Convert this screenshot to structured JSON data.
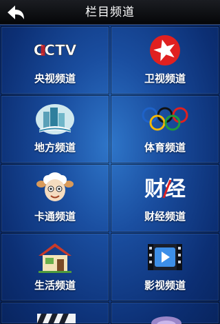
{
  "header": {
    "title": "栏目频道",
    "back_icon": "back-arrow-icon"
  },
  "tiles": [
    {
      "label": "央视频道",
      "icon": "cctv-logo-icon"
    },
    {
      "label": "卫视频道",
      "icon": "star-tv-logo-icon"
    },
    {
      "label": "地方频道",
      "icon": "city-buildings-icon"
    },
    {
      "label": "体育频道",
      "icon": "olympic-rings-icon"
    },
    {
      "label": "卡通频道",
      "icon": "cartoon-sheep-icon"
    },
    {
      "label": "财经频道",
      "icon": "finance-logo-icon"
    },
    {
      "label": "生活频道",
      "icon": "house-icon"
    },
    {
      "label": "影视频道",
      "icon": "film-play-icon"
    }
  ],
  "logos": {
    "cctv_text": "CCTV",
    "finance_text": "财经"
  },
  "colors": {
    "accent_red": "#e02020",
    "header_bg": "#0a0b0e",
    "grid_bg": "#1a4ea0"
  }
}
